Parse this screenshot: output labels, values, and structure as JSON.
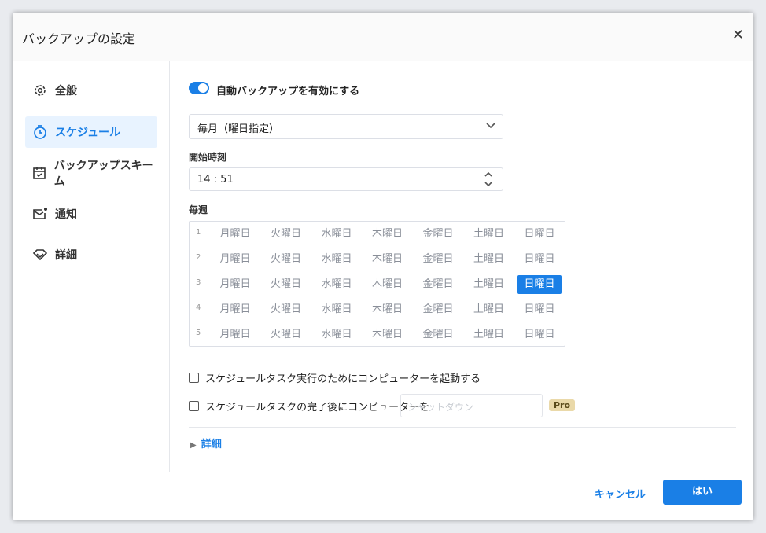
{
  "title": "バックアップの設定",
  "sidebar": {
    "items": [
      {
        "label": "全般",
        "icon": "gear-icon"
      },
      {
        "label": "スケジュール",
        "icon": "timer-icon"
      },
      {
        "label": "バックアップスキーム",
        "icon": "calendar-check-icon"
      },
      {
        "label": "通知",
        "icon": "mail-icon"
      },
      {
        "label": "詳細",
        "icon": "diamond-icon"
      }
    ]
  },
  "main": {
    "toggle_label": "自動バックアップを有効にする",
    "toggle_on": true,
    "frequency": "毎月（曜日指定）",
    "start_label": "開始時刻",
    "start_time": "14 : 51",
    "week_label": "毎週",
    "weeks": [
      "1",
      "2",
      "3",
      "4",
      "5"
    ],
    "days": [
      "月曜日",
      "火曜日",
      "水曜日",
      "木曜日",
      "金曜日",
      "土曜日",
      "日曜日"
    ],
    "selected": {
      "week": 3,
      "day": "日曜日"
    },
    "wake_label": "スケジュールタスク実行のためにコンピューターを起動する",
    "after_label": "スケジュールタスクの完了後にコンピューターを",
    "after_placeholder": "シャットダウン",
    "pro_badge": "Pro",
    "details_label": "詳細"
  },
  "footer": {
    "cancel": "キャンセル",
    "ok": "はい"
  },
  "colors": {
    "accent": "#1a7fe6"
  }
}
